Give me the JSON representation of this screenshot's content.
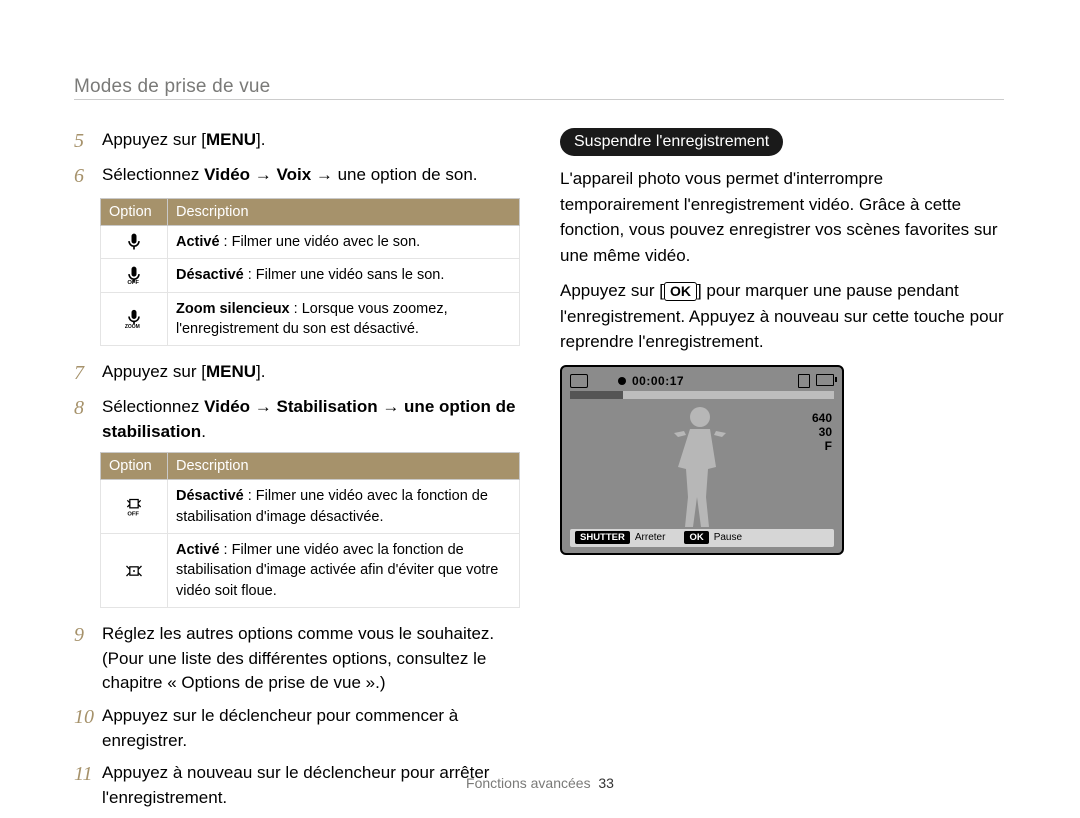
{
  "header": "Modes de prise de vue",
  "steps": {
    "s5_pre": "Appuyez sur [",
    "s5_menu": "MENU",
    "s5_post": "].",
    "s6_pre": "Sélectionnez ",
    "s6_b1": "Vidéo",
    "s6_arrow": " → ",
    "s6_b2": "Voix",
    "s6_post": " → une option de son.",
    "s7_pre": "Appuyez sur [",
    "s7_menu": "MENU",
    "s7_post": "].",
    "s8_pre": "Sélectionnez ",
    "s8_b1": "Vidéo",
    "s8_b2": "Stabilisation",
    "s8_b3": "une option de stabilisation",
    "s8_post": ".",
    "s9": "Réglez les autres options comme vous le souhaitez. (Pour une liste des différentes options, consultez le chapitre « Options de prise de vue ».)",
    "s10": "Appuyez sur le déclencheur pour commencer à enregistrer.",
    "s11": "Appuyez à nouveau sur le déclencheur pour arrêter l'enregistrement."
  },
  "nums": {
    "n5": "5",
    "n6": "6",
    "n7": "7",
    "n8": "8",
    "n9": "9",
    "n10": "10",
    "n11": "11"
  },
  "table1": {
    "h1": "Option",
    "h2": "Description",
    "rows": [
      {
        "icon": "mic",
        "bold": "Activé",
        "rest": " : Filmer une vidéo avec le son."
      },
      {
        "icon": "mic-off",
        "bold": "Désactivé",
        "rest": " : Filmer une vidéo sans le son."
      },
      {
        "icon": "zoom",
        "bold": "Zoom silencieux",
        "rest": " : Lorsque vous zoomez, l'enregistrement du son est désactivé."
      }
    ]
  },
  "table2": {
    "h1": "Option",
    "h2": "Description",
    "rows": [
      {
        "icon": "stab-off",
        "bold": "Désactivé",
        "rest": " : Filmer une vidéo avec la fonction de stabilisation d'image désactivée."
      },
      {
        "icon": "stab-on",
        "bold": "Activé",
        "rest": " : Filmer une vidéo avec la fonction de stabilisation d'image activée afin d'éviter que votre vidéo soit floue."
      }
    ]
  },
  "right": {
    "callout": "Suspendre l'enregistrement",
    "p1": "L'appareil photo vous permet d'interrompre temporairement l'enregistrement vidéo. Grâce à cette fonction, vous pouvez enregistrer vos scènes favorites sur une même vidéo.",
    "p2_pre": "Appuyez sur [",
    "p2_ok": "OK",
    "p2_post": "] pour marquer une pause pendant l'enregistrement. Appuyez à nouveau sur cette touche pour reprendre l'enregistrement."
  },
  "screen": {
    "time": "00:00:17",
    "r1": "640",
    "r2": "30",
    "r3": "F",
    "shutter": "SHUTTER",
    "arreter": "Arreter",
    "ok": "OK",
    "pause": "Pause"
  },
  "footer": {
    "label": "Fonctions avancées",
    "page": "33"
  }
}
